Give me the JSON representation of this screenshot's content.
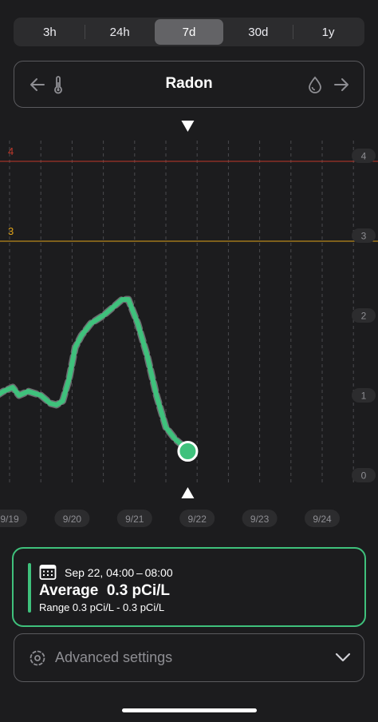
{
  "range_tabs": [
    {
      "label": "3h",
      "active": false
    },
    {
      "label": "24h",
      "active": false
    },
    {
      "label": "7d",
      "active": true
    },
    {
      "label": "30d",
      "active": false
    },
    {
      "label": "1y",
      "active": false
    }
  ],
  "sensor": {
    "title": "Radon",
    "prev_icon": "arrow-left-icon",
    "left_sensor_icon": "thermometer-icon",
    "right_sensor_icon": "humidity-drop-icon",
    "next_icon": "arrow-right-icon"
  },
  "chart_data": {
    "type": "line",
    "x_ticks": [
      "9/19",
      "9/20",
      "9/21",
      "9/22",
      "9/23",
      "9/24"
    ],
    "y_ticks": [
      "0",
      "1",
      "2",
      "3",
      "4"
    ],
    "ylim": [
      0,
      4
    ],
    "thresholds": [
      {
        "value": 4,
        "label": "4",
        "color": "#c0392b"
      },
      {
        "value": 3,
        "label": "3",
        "color": "#e0a31a"
      }
    ],
    "series": [
      {
        "color": "#3fc17c",
        "points": [
          [
            18.8,
            1.0
          ],
          [
            18.9,
            1.05
          ],
          [
            19.05,
            1.1
          ],
          [
            19.15,
            1.0
          ],
          [
            19.3,
            1.05
          ],
          [
            19.5,
            1.0
          ],
          [
            19.65,
            0.9
          ],
          [
            19.75,
            0.88
          ],
          [
            19.85,
            0.93
          ],
          [
            19.95,
            1.2
          ],
          [
            20.05,
            1.6
          ],
          [
            20.15,
            1.75
          ],
          [
            20.3,
            1.9
          ],
          [
            20.5,
            2.0
          ],
          [
            20.65,
            2.1
          ],
          [
            20.8,
            2.2
          ],
          [
            20.9,
            2.2
          ],
          [
            20.95,
            2.1
          ],
          [
            21.05,
            1.9
          ],
          [
            21.2,
            1.5
          ],
          [
            21.35,
            1.0
          ],
          [
            21.5,
            0.6
          ],
          [
            21.65,
            0.45
          ],
          [
            21.8,
            0.35
          ],
          [
            21.85,
            0.3
          ]
        ]
      }
    ],
    "selected_point": {
      "x": 21.85,
      "y": 0.3
    },
    "grid": "vertical dashed"
  },
  "detail_card": {
    "calendar_icon": "calendar-icon",
    "date_range": "Sep 22, 04:00 – 08:00",
    "average_label": "Average",
    "average_value": "0.3 pCi/L",
    "range_text": "Range 0.3 pCi/L - 0.3 pCi/L"
  },
  "advanced": {
    "label": "Advanced settings",
    "icon": "settings-icon",
    "chevron": "chevron-down-icon"
  }
}
